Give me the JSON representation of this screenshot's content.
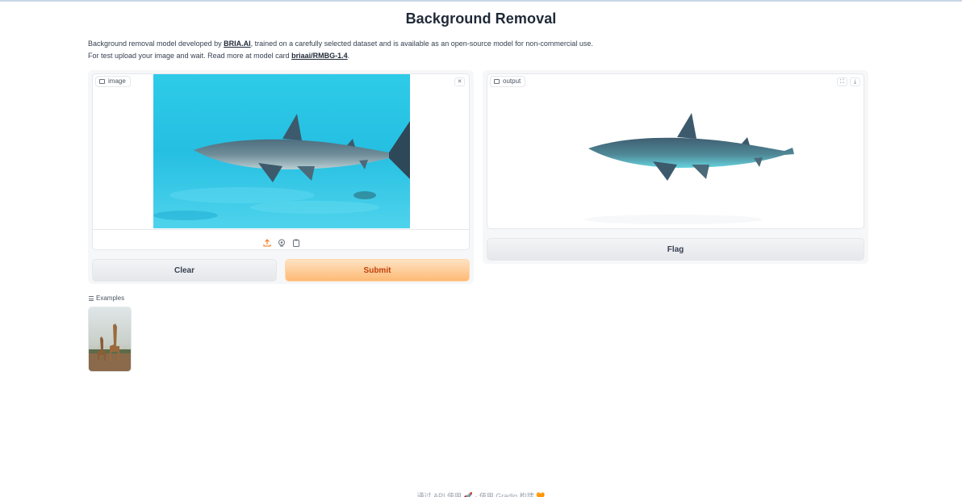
{
  "page": {
    "title": "Background Removal",
    "desc_line1_pre": "Background removal model developed by ",
    "desc_link1": "BRIA.AI",
    "desc_line1_post": ", trained on a carefully selected dataset and is available as an open-source model for non-commercial use.",
    "desc_line2_pre": "For test upload your image and wait. Read more at model card ",
    "desc_link2": "briaai/RMBG-1.4",
    "desc_line2_post": "."
  },
  "input": {
    "label": "image",
    "clear_icon": "close-icon",
    "toolbar_icons": [
      "upload-icon",
      "webcam-icon",
      "clipboard-icon"
    ]
  },
  "output": {
    "label": "output",
    "icons": [
      "fullscreen-icon",
      "download-icon"
    ]
  },
  "buttons": {
    "clear": "Clear",
    "submit": "Submit",
    "flag": "Flag"
  },
  "examples": {
    "label": "Examples"
  },
  "footer": {
    "text": "通过 API 使用 🚀 · 使用 Gradio 构建 🧡"
  },
  "colors": {
    "submit_text": "#c2410c",
    "submit_bg": "#fdba74",
    "water": "#2ec6e6"
  }
}
